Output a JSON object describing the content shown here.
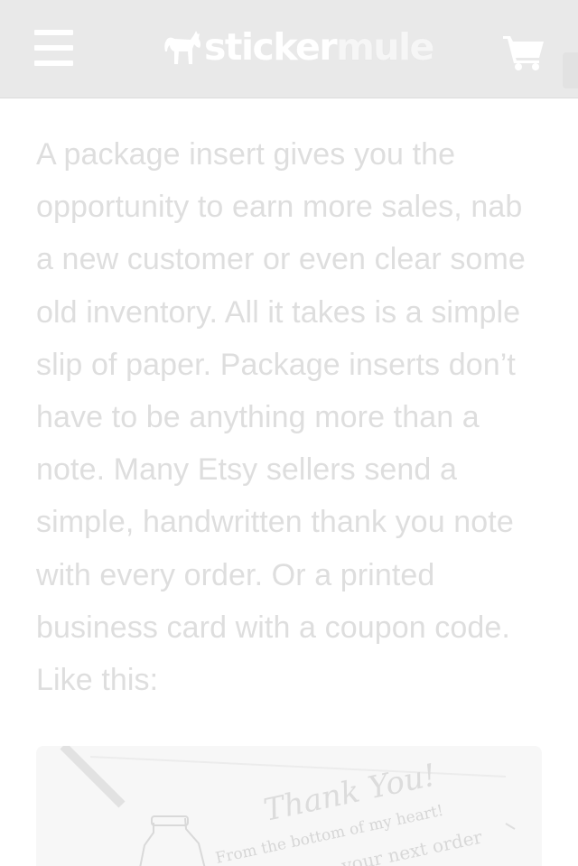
{
  "header": {
    "menu_icon": "hamburger-menu-icon",
    "logo": {
      "word_primary": "sticker",
      "word_secondary": "mule",
      "mascot_icon": "mule-silhouette-icon"
    },
    "cart_icon": "shopping-cart-icon"
  },
  "article": {
    "paragraph": "A package insert gives you the opportunity to earn more sales, nab a new customer or even clear some old inventory. All it takes is a simple slip of paper. Package inserts don’t have to be anything more than a note. Many Etsy sellers send a simple, handwritten thank you note with every order. Or a printed business card with a coupon code. Like this:"
  },
  "image": {
    "card_title": "Thank You!",
    "card_line_1": "From the bottom of my heart!",
    "card_line_2": "your next order"
  },
  "colors": {
    "header_bg": "#e9e9e9",
    "header_icons": "#ffffff",
    "body_text": "#dedede",
    "image_bg": "#f7f7f7"
  }
}
